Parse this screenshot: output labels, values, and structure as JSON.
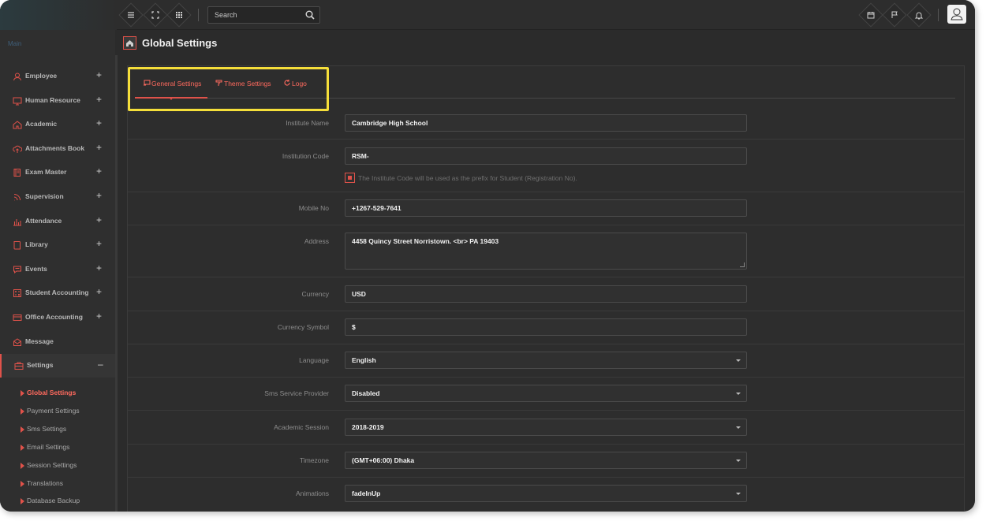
{
  "topbar": {
    "search_placeholder": "Search"
  },
  "sidebar": {
    "section_label": "Main",
    "items": [
      {
        "label": "Employee",
        "icon": "user-icon",
        "expand": "+"
      },
      {
        "label": "Human Resource",
        "icon": "monitor-icon",
        "expand": "+"
      },
      {
        "label": "Academic",
        "icon": "home-icon",
        "expand": "+"
      },
      {
        "label": "Attachments Book",
        "icon": "cloud-upload-icon",
        "expand": "+"
      },
      {
        "label": "Exam Master",
        "icon": "book-icon",
        "expand": "+"
      },
      {
        "label": "Supervision",
        "icon": "rss-icon",
        "expand": "+"
      },
      {
        "label": "Attendance",
        "icon": "bar-chart-icon",
        "expand": "+"
      },
      {
        "label": "Library",
        "icon": "book-open-icon",
        "expand": "+"
      },
      {
        "label": "Events",
        "icon": "message-icon",
        "expand": "+"
      },
      {
        "label": "Student Accounting",
        "icon": "calculator-icon",
        "expand": "+"
      },
      {
        "label": "Office Accounting",
        "icon": "credit-card-icon",
        "expand": "+"
      },
      {
        "label": "Message",
        "icon": "envelope-icon",
        "expand": ""
      },
      {
        "label": "Settings",
        "icon": "briefcase-icon",
        "expand": "–"
      }
    ],
    "sub_items": [
      {
        "label": "Global Settings",
        "current": true
      },
      {
        "label": "Payment Settings",
        "current": false
      },
      {
        "label": "Sms Settings",
        "current": false
      },
      {
        "label": "Email Settings",
        "current": false
      },
      {
        "label": "Session Settings",
        "current": false
      },
      {
        "label": "Translations",
        "current": false
      },
      {
        "label": "Database Backup",
        "current": false
      }
    ]
  },
  "page": {
    "title": "Global Settings"
  },
  "tabs": [
    {
      "label": "General Settings",
      "icon": "settings-tab-icon"
    },
    {
      "label": "Theme Settings",
      "icon": "paint-roller-icon"
    },
    {
      "label": "Logo",
      "icon": "refresh-icon"
    }
  ],
  "form": {
    "institute_name": {
      "label": "Institute Name",
      "value": "Cambridge High School"
    },
    "institution_code": {
      "label": "Institution Code",
      "value": "RSM-"
    },
    "code_hint": "The Institute Code will be used as the prefix for Student (Registration No).",
    "mobile_no": {
      "label": "Mobile No",
      "value": "+1267-529-7641"
    },
    "address": {
      "label": "Address",
      "value": "4458 Quincy Street Norristown. <br> PA 19403"
    },
    "currency": {
      "label": "Currency",
      "value": "USD"
    },
    "currency_symbol": {
      "label": "Currency Symbol",
      "value": "$"
    },
    "language": {
      "label": "Language",
      "value": "English"
    },
    "sms_provider": {
      "label": "Sms Service Provider",
      "value": "Disabled"
    },
    "academic_session": {
      "label": "Academic Session",
      "value": "2018-2019"
    },
    "timezone": {
      "label": "Timezone",
      "value": "(GMT+06:00) Dhaka"
    },
    "animations": {
      "label": "Animations",
      "value": "fadeInUp"
    }
  },
  "colors": {
    "accent": "#e0524a",
    "highlight": "#f5de3a",
    "background": "#2b2b2b"
  }
}
